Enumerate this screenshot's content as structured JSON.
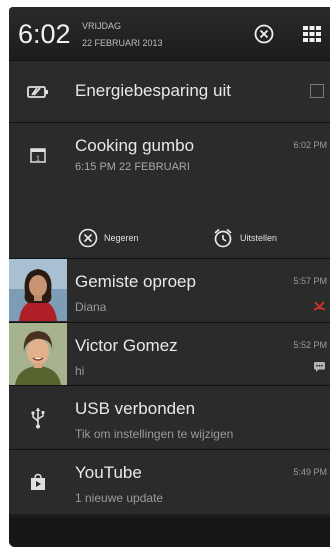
{
  "status": {
    "time": "6:02",
    "day": "VRIJDAG",
    "date": "22 FEBRUARI 2013"
  },
  "notifications": [
    {
      "title": "Energiebesparing uit",
      "icon": "battery-saver-icon"
    },
    {
      "title": "Cooking gumbo",
      "subtitle": "6:15 PM 22 FEBRUARI",
      "time": "6:02 PM",
      "icon": "calendar-icon",
      "actions": {
        "dismiss": "Negeren",
        "snooze": "Uitstellen"
      }
    },
    {
      "title": "Gemiste oproep",
      "subtitle": "Diana",
      "time": "5:57 PM",
      "icon": "missed-call-icon"
    },
    {
      "title": "Victor Gomez",
      "subtitle": "hi",
      "time": "5:52 PM",
      "icon": "message-icon"
    },
    {
      "title": "USB verbonden",
      "subtitle": "Tik om instellingen te wijzigen",
      "icon": "usb-icon"
    },
    {
      "title": "YouTube",
      "subtitle": "1 nieuwe update",
      "time": "5:49 PM",
      "icon": "store-icon"
    }
  ],
  "colors": {
    "missed_call": "#d0342c",
    "background": "#1c1c1c",
    "row": "#2b2b2b"
  }
}
